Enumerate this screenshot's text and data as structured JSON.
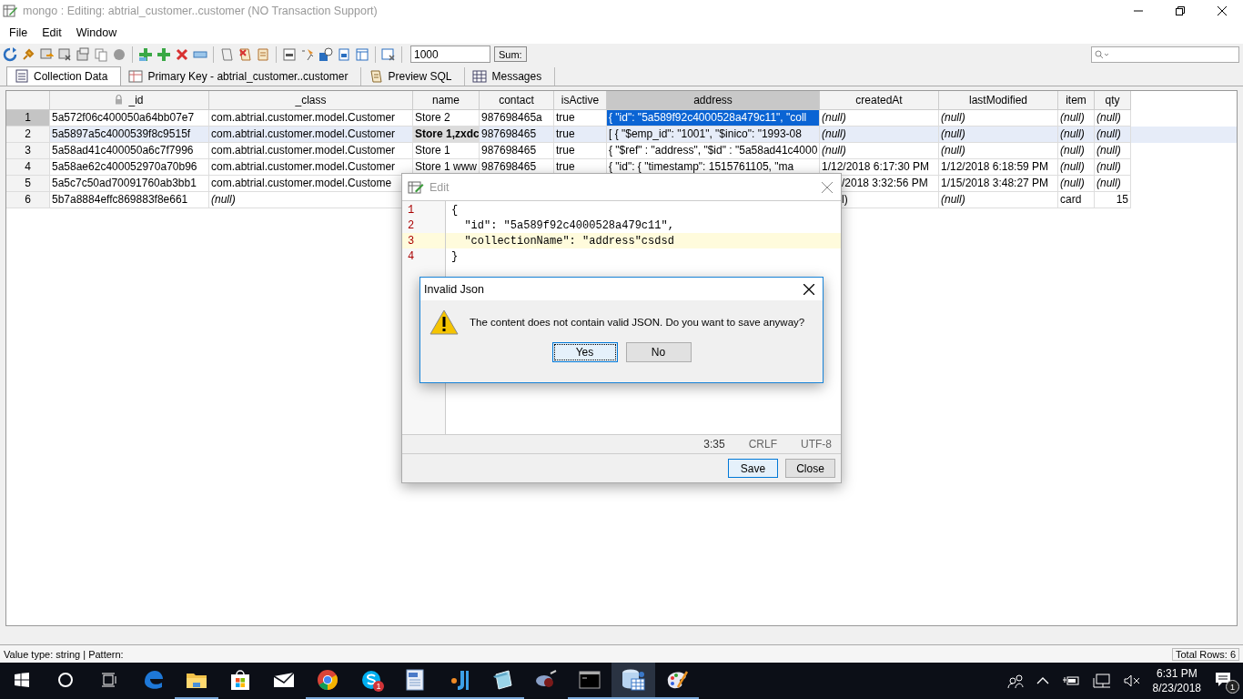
{
  "window": {
    "title": "mongo : Editing: abtrial_customer..customer (NO Transaction Support)"
  },
  "menu": [
    "File",
    "Edit",
    "Window"
  ],
  "toolbar": {
    "limit": "1000",
    "sum_button": "Sum:"
  },
  "tabs": [
    {
      "label": "Collection Data",
      "selected": true
    },
    {
      "label": "Primary Key - abtrial_customer..customer",
      "selected": false
    },
    {
      "label": "Preview SQL",
      "selected": false
    },
    {
      "label": "Messages",
      "selected": false
    }
  ],
  "grid": {
    "columns": [
      {
        "label": "_id",
        "locked": true,
        "selected": false
      },
      {
        "label": "_class",
        "locked": false,
        "selected": false
      },
      {
        "label": "name",
        "locked": false,
        "selected": false
      },
      {
        "label": "contact",
        "locked": false,
        "selected": false
      },
      {
        "label": "isActive",
        "locked": false,
        "selected": false
      },
      {
        "label": "address",
        "locked": false,
        "selected": true
      },
      {
        "label": "createdAt",
        "locked": false,
        "selected": false
      },
      {
        "label": "lastModified",
        "locked": false,
        "selected": false
      },
      {
        "label": "item",
        "locked": false,
        "selected": false
      },
      {
        "label": "qty",
        "locked": false,
        "selected": false
      }
    ],
    "rows": [
      {
        "number": "1",
        "current": true,
        "highlighted": false,
        "cells": [
          {
            "kind": "text",
            "text": "5a572f06c400050a64bb07e7"
          },
          {
            "kind": "text",
            "text": "com.abtrial.customer.model.Customer"
          },
          {
            "kind": "text",
            "text": "Store 2"
          },
          {
            "kind": "text",
            "text": "987698465a"
          },
          {
            "kind": "text",
            "text": "true"
          },
          {
            "kind": "selected",
            "text": "{  \"id\": \"5a589f92c4000528a479c11\",  \"coll"
          },
          {
            "kind": "null",
            "text": "(null)"
          },
          {
            "kind": "null",
            "text": "(null)"
          },
          {
            "kind": "null",
            "text": "(null)"
          },
          {
            "kind": "null",
            "text": "(null)"
          }
        ]
      },
      {
        "number": "2",
        "current": false,
        "highlighted": true,
        "cells": [
          {
            "kind": "text",
            "text": "5a5897a5c4000539f8c9515f"
          },
          {
            "kind": "text",
            "text": "com.abtrial.customer.model.Customer"
          },
          {
            "kind": "bold",
            "text": "Store 1,zxdc"
          },
          {
            "kind": "text",
            "text": "987698465"
          },
          {
            "kind": "text",
            "text": "true"
          },
          {
            "kind": "text",
            "text": "[  {    \"$emp_id\": \"1001\",    \"$inico\": \"1993-08"
          },
          {
            "kind": "null",
            "text": "(null)"
          },
          {
            "kind": "null",
            "text": "(null)"
          },
          {
            "kind": "null",
            "text": "(null)"
          },
          {
            "kind": "null",
            "text": "(null)"
          }
        ]
      },
      {
        "number": "3",
        "current": false,
        "highlighted": false,
        "cells": [
          {
            "kind": "text",
            "text": "5a58ad41c400050a6c7f7996"
          },
          {
            "kind": "text",
            "text": "com.abtrial.customer.model.Customer"
          },
          {
            "kind": "text",
            "text": "Store 1"
          },
          {
            "kind": "text",
            "text": "987698465"
          },
          {
            "kind": "text",
            "text": "true"
          },
          {
            "kind": "text",
            "text": "{ \"$ref\" : \"address\", \"$id\" : \"5a58ad41c4000"
          },
          {
            "kind": "null",
            "text": "(null)"
          },
          {
            "kind": "null",
            "text": "(null)"
          },
          {
            "kind": "null",
            "text": "(null)"
          },
          {
            "kind": "null",
            "text": "(null)"
          }
        ]
      },
      {
        "number": "4",
        "current": false,
        "highlighted": false,
        "cells": [
          {
            "kind": "text",
            "text": "5a58ae62c400052970a70b96"
          },
          {
            "kind": "text",
            "text": "com.abtrial.customer.model.Customer"
          },
          {
            "kind": "text",
            "text": "Store 1 www"
          },
          {
            "kind": "text",
            "text": "987698465"
          },
          {
            "kind": "text",
            "text": "true"
          },
          {
            "kind": "text",
            "text": "{  \"id\": {    \"timestamp\": 1515761105,    \"ma"
          },
          {
            "kind": "text",
            "text": "1/12/2018 6:17:30 PM"
          },
          {
            "kind": "text",
            "text": "1/12/2018 6:18:59 PM"
          },
          {
            "kind": "null",
            "text": "(null)"
          },
          {
            "kind": "null",
            "text": "(null)"
          }
        ]
      },
      {
        "number": "5",
        "current": false,
        "highlighted": false,
        "cells": [
          {
            "kind": "text",
            "text": "5a5c7c50ad70091760ab3bb1"
          },
          {
            "kind": "text",
            "text": "com.abtrial.customer.model.Custome"
          },
          {
            "kind": "hidden"
          },
          {
            "kind": "hidden"
          },
          {
            "kind": "hidden"
          },
          {
            "kind": "hidden"
          },
          {
            "kind": "partial",
            "text": "/2018 3:32:56 PM"
          },
          {
            "kind": "text",
            "text": "1/15/2018 3:48:27 PM"
          },
          {
            "kind": "null",
            "text": "(null)"
          },
          {
            "kind": "null",
            "text": "(null)"
          }
        ]
      },
      {
        "number": "6",
        "current": false,
        "highlighted": false,
        "cells": [
          {
            "kind": "text",
            "text": "5b7a8884effc869883f8e661"
          },
          {
            "kind": "null",
            "text": "(null)"
          },
          {
            "kind": "hidden"
          },
          {
            "kind": "hidden"
          },
          {
            "kind": "hidden"
          },
          {
            "kind": "hidden"
          },
          {
            "kind": "partial",
            "text": "l)"
          },
          {
            "kind": "null",
            "text": "(null)"
          },
          {
            "kind": "text",
            "text": "card"
          },
          {
            "kind": "number",
            "text": "15"
          }
        ]
      }
    ]
  },
  "edit_dialog": {
    "title": "Edit",
    "lines": [
      {
        "number": "1",
        "text": "{",
        "current": false
      },
      {
        "number": "2",
        "text": "  \"id\": \"5a589f92c4000528a479c11\",",
        "current": false
      },
      {
        "number": "3",
        "text": "  \"collectionName\": \"address\"csdsd",
        "current": true
      },
      {
        "number": "4",
        "text": "}",
        "current": false
      }
    ],
    "status": [
      "3:35",
      "CRLF",
      "UTF-8"
    ],
    "buttons": [
      {
        "label": "Save",
        "default": true
      },
      {
        "label": "Close",
        "default": false
      }
    ]
  },
  "alert": {
    "title": "Invalid Json",
    "message": "The content does not contain valid JSON. Do you want to save anyway?",
    "buttons": [
      {
        "label": "Yes",
        "focused": true
      },
      {
        "label": "No",
        "focused": false
      }
    ]
  },
  "status_bar": {
    "left": "Value type: string | Pattern:",
    "right": "Total Rows: 6"
  },
  "taskbar": {
    "apps": [
      {
        "kind": "start",
        "running": false,
        "active": false
      },
      {
        "kind": "cortana",
        "running": false,
        "active": false
      },
      {
        "kind": "taskview",
        "running": false,
        "active": false
      },
      {
        "kind": "edge",
        "running": false,
        "active": false
      },
      {
        "kind": "explorer",
        "running": true,
        "active": false
      },
      {
        "kind": "store",
        "running": false,
        "active": false
      },
      {
        "kind": "mail",
        "running": false,
        "active": false
      },
      {
        "kind": "chrome",
        "running": true,
        "active": false
      },
      {
        "kind": "skype",
        "running": true,
        "active": false,
        "badge": "1"
      },
      {
        "kind": "document",
        "running": true,
        "active": false
      },
      {
        "kind": "ide",
        "running": true,
        "active": false
      },
      {
        "kind": "notepad",
        "running": true,
        "active": false
      },
      {
        "kind": "tool",
        "running": false,
        "active": false
      },
      {
        "kind": "console",
        "running": true,
        "active": false
      },
      {
        "kind": "database",
        "running": true,
        "active": true
      },
      {
        "kind": "paint",
        "running": true,
        "active": false
      }
    ],
    "time": "6:31 PM",
    "date": "8/23/2018",
    "notifications": "1"
  }
}
